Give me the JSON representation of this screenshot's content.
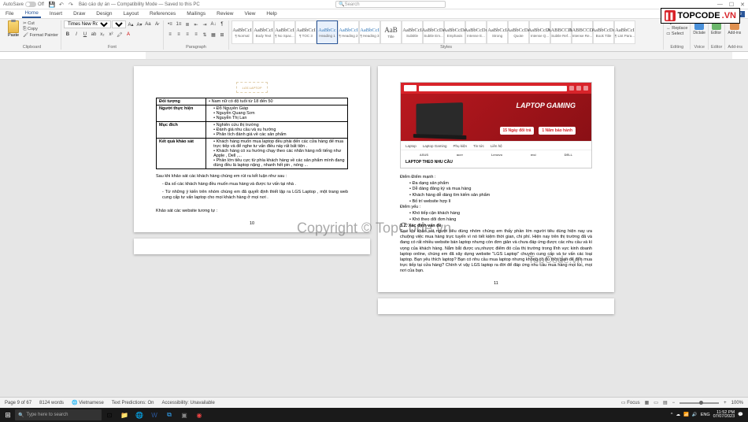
{
  "titlebar": {
    "autosave_label": "AutoSave",
    "autosave_state": "Off",
    "doc_title": "Báo cáo dự án — Compatibility Mode — Saved to this PC",
    "search_placeholder": "Search"
  },
  "menu": {
    "tabs": [
      "File",
      "Home",
      "Insert",
      "Draw",
      "Design",
      "Layout",
      "References",
      "Mailings",
      "Review",
      "View",
      "Help"
    ],
    "active": "Home",
    "share": "Share"
  },
  "ribbon": {
    "clipboard": {
      "paste": "Paste",
      "cut": "Cut",
      "copy": "Copy",
      "format_painter": "Format Painter",
      "label": "Clipboard"
    },
    "font": {
      "name": "Times New Roman",
      "size": "13",
      "label": "Font"
    },
    "paragraph": {
      "label": "Paragraph"
    },
    "styles": {
      "label": "Styles",
      "items": [
        {
          "preview": "AaBbCcI",
          "label": "¶ Normal"
        },
        {
          "preview": "AaBbCcI",
          "label": "Body Text"
        },
        {
          "preview": "AaBbCcI",
          "label": "¶ No Spac..."
        },
        {
          "preview": "AaBbCcI",
          "label": "¶ TOC 3"
        },
        {
          "preview": "AaBbCc",
          "label": "Heading 1",
          "heading": true,
          "active": true
        },
        {
          "preview": "AaBbCcI",
          "label": "¶ Heading 2",
          "heading": true
        },
        {
          "preview": "AaBbCcI",
          "label": "¶ Heading 3",
          "heading": true
        },
        {
          "preview": "AaB",
          "label": "Title",
          "title": true
        },
        {
          "preview": "AaBbCcI",
          "label": "Subtitle"
        },
        {
          "preview": "AaBbCcDc",
          "label": "Subtle Em..."
        },
        {
          "preview": "AaBbCcDc",
          "label": "Emphasis"
        },
        {
          "preview": "AaBbCcDc",
          "label": "Intense E..."
        },
        {
          "preview": "AaBbCcI",
          "label": "Strong"
        },
        {
          "preview": "AaBbCcDc",
          "label": "Quote"
        },
        {
          "preview": "AaBbCcDc",
          "label": "Intense Q..."
        },
        {
          "preview": "AABBCCDE",
          "label": "Subtle Ref..."
        },
        {
          "preview": "AABBCCDE",
          "label": "Intense Re..."
        },
        {
          "preview": "AaBbCcDc",
          "label": "Book Title"
        },
        {
          "preview": "AaBbCcI",
          "label": "¶ List Para..."
        }
      ]
    },
    "editing": {
      "find": "Find",
      "replace": "Replace",
      "select": "Select",
      "label": "Editing"
    },
    "addins": {
      "dictate": "Dictate",
      "editor": "Editor",
      "addins": "Add-ins",
      "voice_label": "Voice",
      "editor_label": "Editor",
      "addins_label": "Add-ins"
    }
  },
  "page_left": {
    "logo": "LGS LAPTOP",
    "table": {
      "rows": [
        {
          "h": "Đối tượng",
          "c": [
            "Nam nữ có độ tuổi từ 18 đến 50"
          ]
        },
        {
          "h": "Người thực hiện",
          "c": [
            "Đỗ Nguyên Giáp",
            "Nguyễn Quang Sơn",
            "Nguyễn Thị Lan"
          ]
        },
        {
          "h": "Mục đích",
          "c": [
            "Nghiên cứu thị trường",
            "Đánh giá nhu cầu và xu hướng",
            "Phân tích đánh giá về các sản phẩm"
          ]
        },
        {
          "h": "Kết quả khảo sát",
          "c": [
            "Khách hàng muốn mua laptop đều phải đến các cửa hàng để mua trực tiếp và để nghe tư vấn điều này rất bất tiện .",
            "Khách hàng có xu hướng chạy theo các nhãn hàng nổi tiếng như Apple , Dell ,...",
            "Phần lớn tiêu cực từ phía khách hàng về các sản phẩm mình đang dùng đều là laptop nặng , nhanh hết pin , nóng ..."
          ]
        }
      ]
    },
    "para1": "Sau khi khảo sát các khách hàng chúng em rút ra kết luận như sau :",
    "bullets": [
      "- Đa số các khách hàng đều muốn mua hàng và được tư vấn tại nhà .",
      "- Từ những ý kiến trên nhóm chúng em đã quyết định thiết lập ra LGS Laptop , một trang web cung cấp tư vấn laptop cho mọi khách hàng ở mọi nơi ."
    ],
    "para2": "Khảo sát các website tương tự :",
    "pagenum": "10"
  },
  "page_right": {
    "website": {
      "banner_text": "LAPTOP GAMING",
      "badge1": "15 Ngày đổi trả",
      "badge2": "1 Năm bảo hành",
      "nav": [
        "Laptop",
        "Laptop Gaming",
        "Phụ kiện",
        "Tin tức",
        "Liên hệ"
      ],
      "brands": [
        "ASUS",
        "acer",
        "Lenovo",
        "msi",
        "DELL"
      ],
      "section": "LAPTOP THEO NHU CẦU"
    },
    "diem_manh_h": "Điểm mạnh :",
    "diem_manh": [
      "Đa dạng sản phẩm",
      "Dễ dàng đăng ký và mua hàng",
      "Khách hàng dễ dàng tìm kiếm sản phẩm",
      "Bố trí website hợp lí"
    ],
    "diem_yeu_h": "Điểm yếu :",
    "diem_yeu": [
      "Khó tiếp cận khách hàng",
      "Khó theo dõi đơn hàng"
    ],
    "section_num": "3.2. Xác định vấn đề",
    "body": "Sau khi khảo sát người tiêu dùng nhóm chúng em thấy phần lớn người tiêu dùng hiện nay ưa chuộng việc mua hàng trực tuyến vì nó tiết kiệm thời gian, chi phí. Hiện nay trên thị trường đã và đang có rất nhiều website bán laptop nhưng còn đơn giản và chưa đáp ứng được các nhu cầu và kì vọng của khách hàng. Nắm bắt được ưu,nhược điểm đó của thị trường trong lĩnh vực kinh doanh laptop online, chúng em đã xây dựng website \"LGS Laptop\" chuyên cung cấp và tư vấn các loại laptop. Bạn yêu thích laptop? Bạn có nhu cầu mua laptop nhưng không có đủ thời gian để đến mua trực tiếp tại cửa hàng? Chính vì vậy LGS laptop ra đời để đáp ứng nhu cầu mua hàng mọi lúc, mọi nơi của bạn.",
    "pagenum": "11"
  },
  "statusbar": {
    "page": "Page 9 of 67",
    "words": "8124 words",
    "lang": "Vietnamese",
    "predictions": "Text Predictions: On",
    "accessibility": "Accessibility: Unavailable",
    "focus": "Focus",
    "zoom": "100%"
  },
  "taskbar": {
    "search": "Type here to search",
    "time": "11:52 PM",
    "date": "07/07/2023"
  },
  "watermarks": {
    "topcode": "TOPCODE",
    "topcode_suffix": ".VN",
    "center": "Copyright © TopCode.vn",
    "page2": "TopCode.vn"
  }
}
